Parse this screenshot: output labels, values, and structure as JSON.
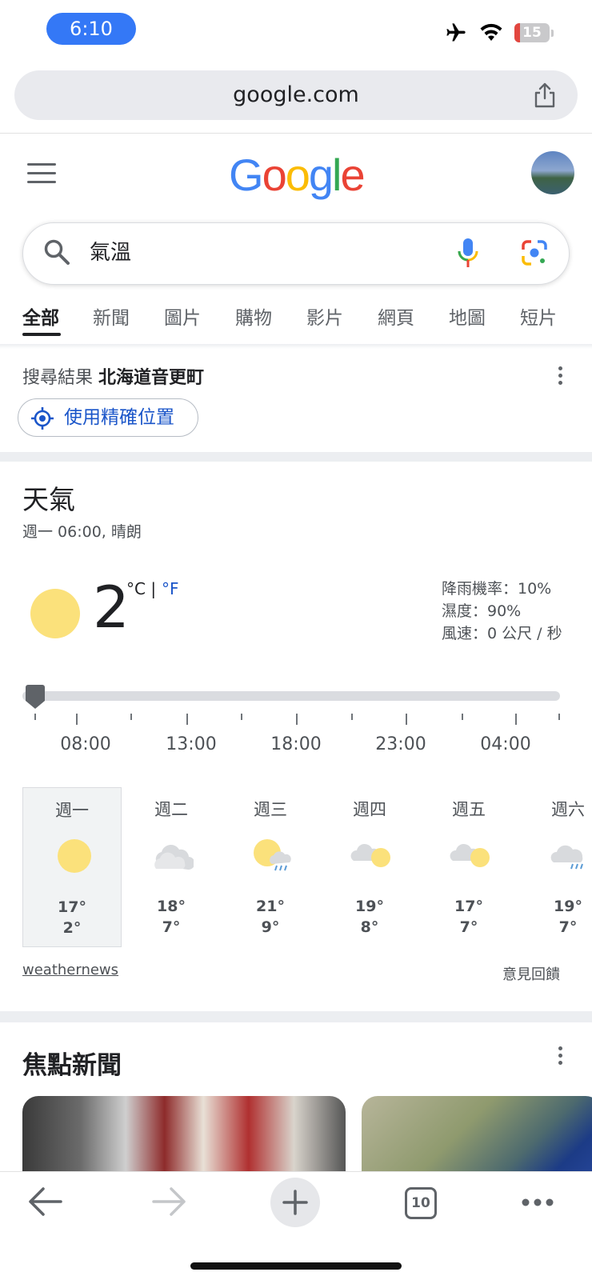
{
  "status_bar": {
    "time": "6:10",
    "battery_level": "15",
    "icons": [
      "airplane-icon",
      "wifi-icon",
      "battery-icon"
    ]
  },
  "browser": {
    "url": "google.com",
    "share_icon": "share-icon",
    "tab_count": "10"
  },
  "header": {
    "logo_text": [
      "G",
      "o",
      "o",
      "g",
      "l",
      "e"
    ],
    "logo_colors": [
      "#4285F4",
      "#EA4335",
      "#FBBC05",
      "#4285F4",
      "#34A853",
      "#EA4335"
    ]
  },
  "search": {
    "query": "氣溫"
  },
  "tabs": [
    {
      "label": "全部",
      "active": true
    },
    {
      "label": "新聞"
    },
    {
      "label": "圖片"
    },
    {
      "label": "購物"
    },
    {
      "label": "影片"
    },
    {
      "label": "網頁"
    },
    {
      "label": "地圖"
    },
    {
      "label": "短片"
    }
  ],
  "location": {
    "prefix": "搜尋結果",
    "place": "北海道音更町",
    "precise_button": "使用精確位置"
  },
  "weather": {
    "title": "天氣",
    "subtitle": "週一 06:00, 晴朗",
    "temperature": "2",
    "unit_c": "°C",
    "unit_sep": " | ",
    "unit_f": "°F",
    "precipitation": "降雨機率：10%",
    "humidity": "濕度：90%",
    "wind": "風速：0 公尺 / 秒",
    "timeline_labels": [
      "08:00",
      "13:00",
      "18:00",
      "23:00",
      "04:00"
    ],
    "days": [
      {
        "name": "週一",
        "icon": "sunny-icon",
        "high": "17°",
        "low": "2°",
        "selected": true
      },
      {
        "name": "週二",
        "icon": "cloudy-icon",
        "high": "18°",
        "low": "7°"
      },
      {
        "name": "週三",
        "icon": "sun-rain-icon",
        "high": "21°",
        "low": "9°"
      },
      {
        "name": "週四",
        "icon": "partly-cloudy-icon",
        "high": "19°",
        "low": "8°"
      },
      {
        "name": "週五",
        "icon": "partly-cloudy-icon",
        "high": "17°",
        "low": "7°"
      },
      {
        "name": "週六",
        "icon": "cloud-rain-icon",
        "high": "19°",
        "low": "7°"
      }
    ],
    "source": "weathernews",
    "feedback": "意見回饋"
  },
  "news": {
    "title": "焦點新聞"
  },
  "colors": {
    "accent_blue": "#1a55c9",
    "sun_yellow": "#fbe17b",
    "status_blue": "#3478f6",
    "battery_red": "#e2463f"
  }
}
